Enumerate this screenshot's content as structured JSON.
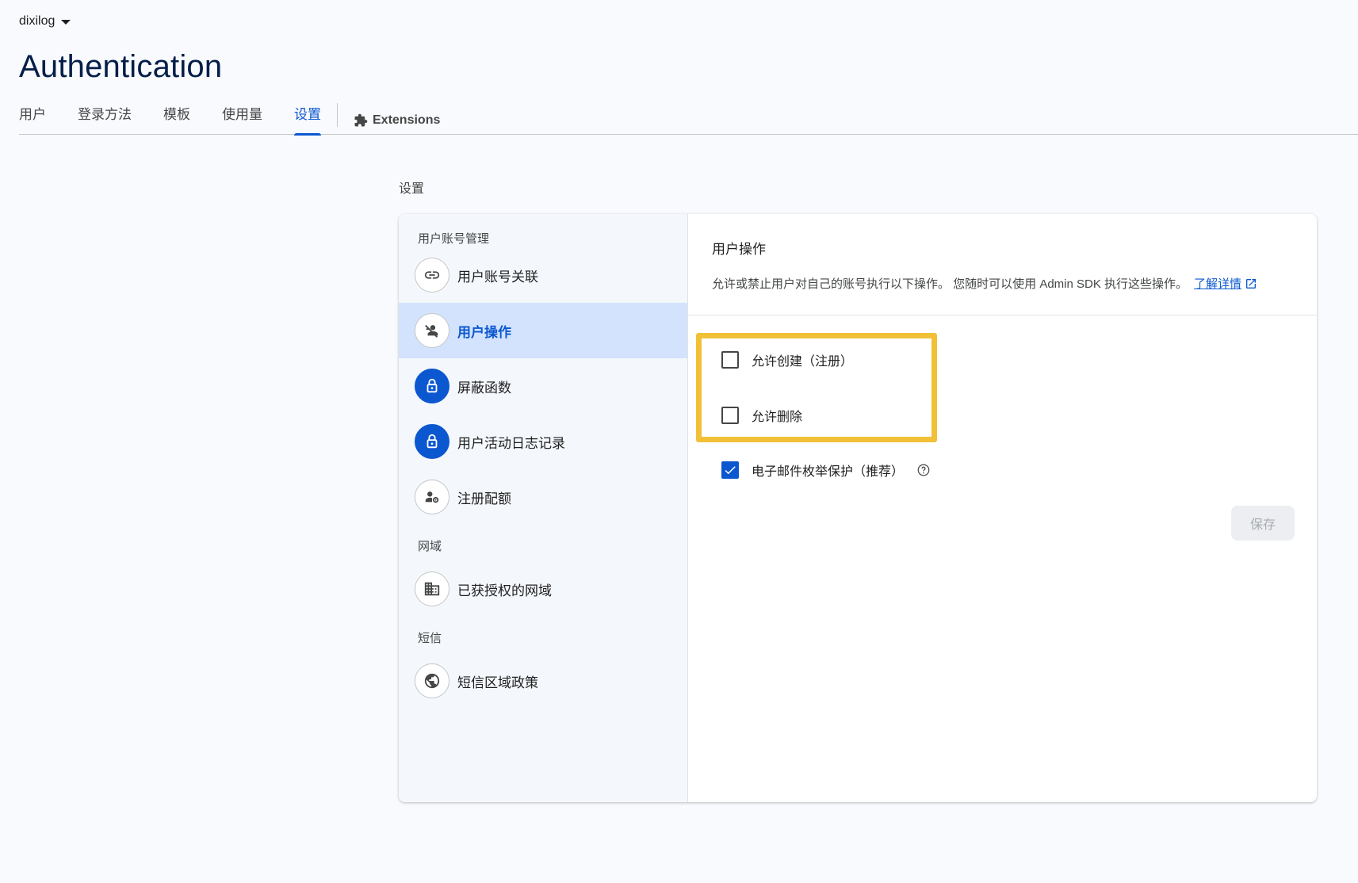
{
  "project": {
    "name": "dixilog"
  },
  "page": {
    "title": "Authentication"
  },
  "tabs": [
    {
      "label": "用户"
    },
    {
      "label": "登录方法"
    },
    {
      "label": "模板"
    },
    {
      "label": "使用量"
    },
    {
      "label": "设置"
    }
  ],
  "extensions_tab": {
    "label": "Extensions"
  },
  "settings": {
    "section_label": "设置"
  },
  "sidebar": {
    "group1": "用户账号管理",
    "items_group1": [
      {
        "label": "用户账号关联",
        "icon": "link-icon"
      },
      {
        "label": "用户操作",
        "icon": "person-off-icon"
      },
      {
        "label": "屏蔽函数",
        "icon": "lock-icon"
      },
      {
        "label": "用户活动日志记录",
        "icon": "lock-icon"
      },
      {
        "label": "注册配额",
        "icon": "person-settings-icon"
      }
    ],
    "group2": "网域",
    "items_group2": [
      {
        "label": "已获授权的网域",
        "icon": "domain-icon"
      }
    ],
    "group3": "短信",
    "items_group3": [
      {
        "label": "短信区域政策",
        "icon": "globe-icon"
      }
    ]
  },
  "content": {
    "title": "用户操作",
    "description": "允许或禁止用户对自己的账号执行以下操作。 您随时可以使用 Admin SDK 执行这些操作。",
    "learn_more": "了解详情",
    "options": [
      {
        "label": "允许创建（注册）",
        "checked": false
      },
      {
        "label": "允许删除",
        "checked": false
      },
      {
        "label": "电子邮件枚举保护（推荐）",
        "checked": true
      }
    ],
    "save_label": "保存"
  },
  "colors": {
    "accent": "#0b57d0",
    "highlight": "#f2c037",
    "active_bg": "#d3e3fd"
  }
}
